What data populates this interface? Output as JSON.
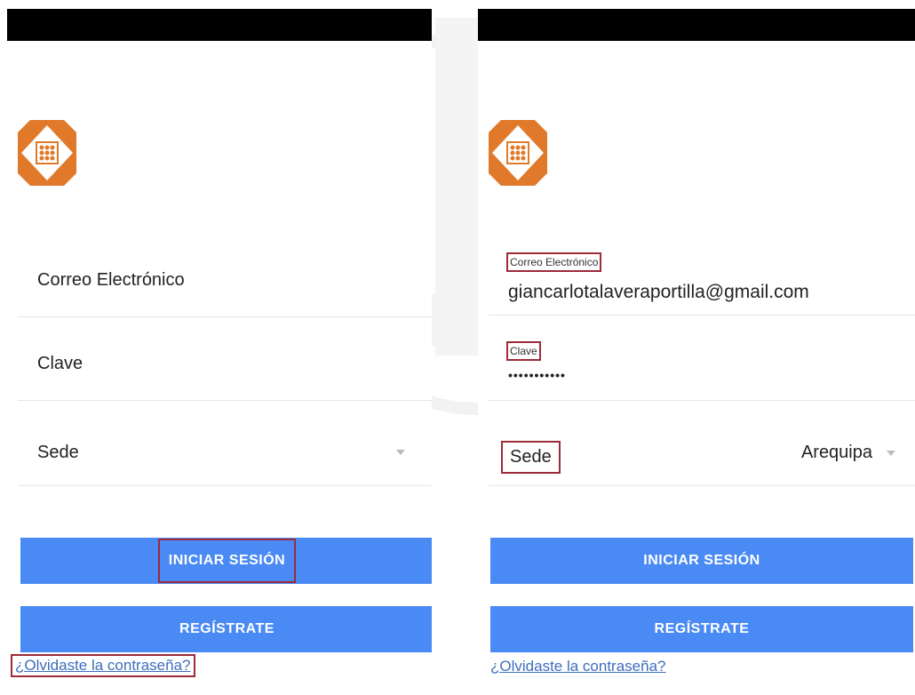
{
  "theme": {
    "primary_button": "#4a8af4",
    "highlight_box": "#9e2a3a",
    "link": "#3d6ebc",
    "logo_orange": "#e07a2a"
  },
  "screens": [
    {
      "state": "empty",
      "email": {
        "placeholder": "Correo Electrónico"
      },
      "password": {
        "placeholder": "Clave"
      },
      "sede": {
        "label": "Sede",
        "selected": ""
      },
      "login_button": "INICIAR SESIÓN",
      "register_button": "REGÍSTRATE",
      "forgot_link": "¿Olvidaste la contraseña?"
    },
    {
      "state": "filled",
      "email": {
        "label": "Correo Electrónico",
        "value": "giancarlotalaveraportilla@gmail.com"
      },
      "password": {
        "label": "Clave",
        "value": "•••••••••••"
      },
      "sede": {
        "label": "Sede",
        "selected": "Arequipa"
      },
      "login_button": "INICIAR SESIÓN",
      "register_button": "REGÍSTRATE",
      "forgot_link": "¿Olvidaste la contraseña?"
    }
  ],
  "icons": {
    "logo": "andean-cross-logo-icon",
    "dropdown": "chevron-down-icon"
  }
}
